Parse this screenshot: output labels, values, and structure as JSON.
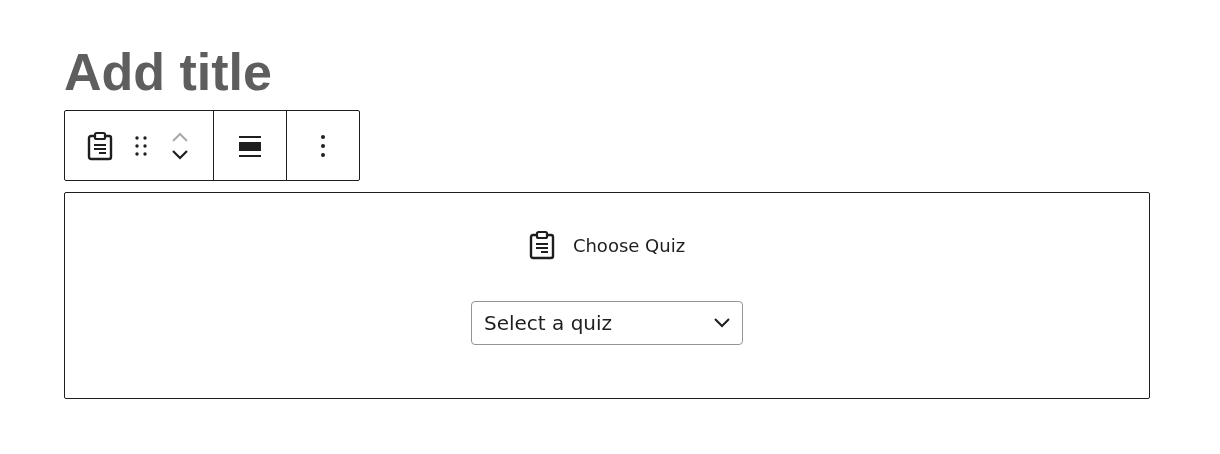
{
  "title": {
    "placeholder": "Add title"
  },
  "toolbar": {
    "move_up_disabled": true,
    "move_down_disabled": false
  },
  "block": {
    "label": "Choose Quiz",
    "select": {
      "value": "Select a quiz"
    }
  }
}
